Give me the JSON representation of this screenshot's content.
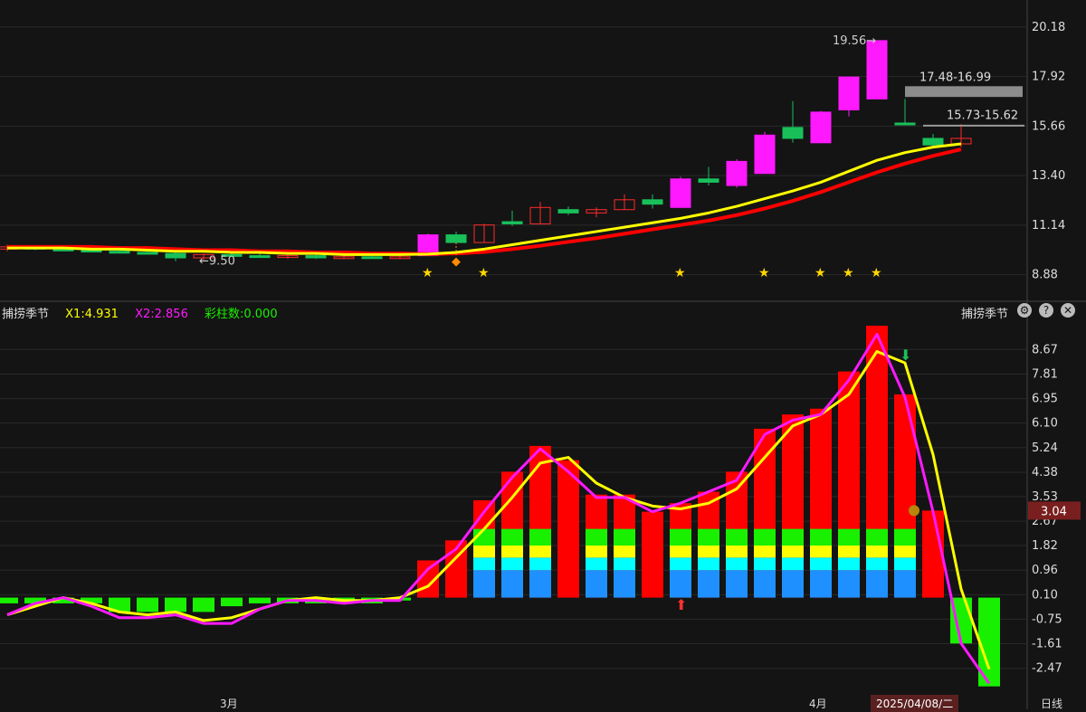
{
  "chart_data": [
    {
      "type": "candlestick",
      "price_axis_ticks": [
        "20.18",
        "17.92",
        "15.66",
        "13.40",
        "11.14",
        "8.88"
      ],
      "ylim": [
        8.0,
        21.0
      ],
      "candles": [
        {
          "o": 10.05,
          "h": 10.25,
          "l": 9.95,
          "c": 10.15
        },
        {
          "o": 10.15,
          "h": 10.2,
          "l": 10.0,
          "c": 10.05
        },
        {
          "o": 10.05,
          "h": 10.15,
          "l": 9.95,
          "c": 10.0
        },
        {
          "o": 10.0,
          "h": 10.1,
          "l": 9.9,
          "c": 9.95
        },
        {
          "o": 9.95,
          "h": 10.05,
          "l": 9.85,
          "c": 9.9
        },
        {
          "o": 9.9,
          "h": 10.0,
          "l": 9.8,
          "c": 9.85
        },
        {
          "o": 9.85,
          "h": 9.95,
          "l": 9.5,
          "c": 9.65
        },
        {
          "o": 9.65,
          "h": 9.85,
          "l": 9.55,
          "c": 9.8
        },
        {
          "o": 9.8,
          "h": 9.9,
          "l": 9.7,
          "c": 9.75
        },
        {
          "o": 9.75,
          "h": 9.85,
          "l": 9.65,
          "c": 9.7
        },
        {
          "o": 9.7,
          "h": 9.8,
          "l": 9.6,
          "c": 9.75
        },
        {
          "o": 9.75,
          "h": 9.8,
          "l": 9.6,
          "c": 9.65
        },
        {
          "o": 9.65,
          "h": 9.75,
          "l": 9.6,
          "c": 9.7
        },
        {
          "o": 9.7,
          "h": 9.75,
          "l": 9.6,
          "c": 9.65
        },
        {
          "o": 9.65,
          "h": 9.75,
          "l": 9.6,
          "c": 9.7
        },
        {
          "o": 9.75,
          "h": 10.75,
          "l": 9.75,
          "c": 10.7
        },
        {
          "o": 10.7,
          "h": 10.85,
          "l": 10.3,
          "c": 10.35
        },
        {
          "o": 10.35,
          "h": 11.2,
          "l": 10.35,
          "c": 11.15
        },
        {
          "o": 11.3,
          "h": 11.8,
          "l": 11.1,
          "c": 11.2
        },
        {
          "o": 11.2,
          "h": 12.2,
          "l": 11.2,
          "c": 11.95
        },
        {
          "o": 11.85,
          "h": 12.0,
          "l": 11.6,
          "c": 11.7
        },
        {
          "o": 11.7,
          "h": 11.95,
          "l": 11.5,
          "c": 11.85
        },
        {
          "o": 11.85,
          "h": 12.55,
          "l": 11.85,
          "c": 12.3
        },
        {
          "o": 12.3,
          "h": 12.55,
          "l": 11.9,
          "c": 12.1
        },
        {
          "o": 11.95,
          "h": 13.35,
          "l": 11.95,
          "c": 13.25
        },
        {
          "o": 13.25,
          "h": 13.8,
          "l": 12.95,
          "c": 13.1
        },
        {
          "o": 12.95,
          "h": 14.15,
          "l": 12.85,
          "c": 14.05
        },
        {
          "o": 13.5,
          "h": 15.4,
          "l": 13.5,
          "c": 15.25
        },
        {
          "o": 15.6,
          "h": 16.8,
          "l": 14.9,
          "c": 15.1
        },
        {
          "o": 14.9,
          "h": 16.35,
          "l": 14.9,
          "c": 16.3
        },
        {
          "o": 16.4,
          "h": 17.9,
          "l": 16.1,
          "c": 17.9
        },
        {
          "o": 16.9,
          "h": 19.56,
          "l": 16.9,
          "c": 19.56
        },
        {
          "o": 15.8,
          "h": 16.9,
          "l": 15.7,
          "c": 15.73
        },
        {
          "o": 15.1,
          "h": 15.3,
          "l": 14.75,
          "c": 14.8
        },
        {
          "o": 14.85,
          "h": 15.75,
          "l": 14.7,
          "c": 15.1
        }
      ],
      "ma_yellow": [
        10.1,
        10.1,
        10.1,
        10.05,
        10.05,
        10.0,
        9.95,
        9.95,
        9.9,
        9.9,
        9.85,
        9.85,
        9.8,
        9.8,
        9.8,
        9.82,
        9.9,
        10.05,
        10.25,
        10.45,
        10.65,
        10.85,
        11.05,
        11.25,
        11.45,
        11.7,
        12.0,
        12.35,
        12.7,
        13.1,
        13.6,
        14.1,
        14.45,
        14.7,
        14.85
      ],
      "ma_red": [
        10.15,
        10.15,
        10.15,
        10.15,
        10.1,
        10.1,
        10.05,
        10.0,
        10.0,
        9.95,
        9.95,
        9.9,
        9.9,
        9.85,
        9.85,
        9.82,
        9.85,
        9.92,
        10.05,
        10.2,
        10.38,
        10.55,
        10.75,
        10.95,
        11.15,
        11.35,
        11.6,
        11.9,
        12.25,
        12.65,
        13.1,
        13.55,
        13.95,
        14.3,
        14.6
      ],
      "annotations": {
        "high_label": "19.56→",
        "low_label": "←9.50",
        "band1": "17.48-16.99",
        "band2": "15.73-15.62"
      }
    },
    {
      "type": "bar+line",
      "indicator_name": "捕捞季节",
      "legend": {
        "x1": "X1:4.931",
        "x2": "X2:2.856",
        "bars": "彩柱数:0.000"
      },
      "value_axis_ticks": [
        "8.67",
        "7.81",
        "6.95",
        "6.10",
        "5.24",
        "4.38",
        "3.53",
        "2.67",
        "1.82",
        "0.96",
        "0.10",
        "-0.75",
        "-1.61",
        "-2.47"
      ],
      "current_value_label": "3.04",
      "ylim": [
        -3.3,
        9.5
      ],
      "bars": [
        -0.2,
        -0.2,
        -0.2,
        -0.2,
        -0.5,
        -0.5,
        -0.5,
        -0.5,
        -0.3,
        -0.2,
        -0.2,
        -0.2,
        -0.2,
        -0.2,
        -0.1,
        1.3,
        2.0,
        3.4,
        4.4,
        5.3,
        4.8,
        3.6,
        3.6,
        3.0,
        3.3,
        3.7,
        4.4,
        5.9,
        6.4,
        6.6,
        7.9,
        9.5,
        7.1,
        3.04,
        -1.6,
        -3.1
      ],
      "bar_colors": [
        "#19f000",
        "#19f000",
        "#19f000",
        "#19f000",
        "#19f000",
        "#19f000",
        "#19f000",
        "#19f000",
        "#19f000",
        "#19f000",
        "#19f000",
        "#19f000",
        "#19f000",
        "#19f000",
        "#19f000",
        "#ff0000",
        "#ff0000",
        "#ff0000",
        "#ff0000",
        "#ff0000",
        "#ff0000",
        "#ff0000",
        "#ff0000",
        "#ff0000",
        "#ff0000",
        "#ff0000",
        "#ff0000",
        "#ff0000",
        "#ff0000",
        "#ff0000",
        "#ff0000",
        "#ff0000",
        "#ff0000",
        "#ff0000",
        "#19f000",
        "#19f000"
      ],
      "rainbow_bars": [
        17,
        18,
        19,
        21,
        22,
        24,
        25,
        26,
        27,
        28,
        29,
        30,
        31,
        32
      ],
      "x1_yellow": [
        -0.6,
        -0.3,
        0.0,
        -0.2,
        -0.5,
        -0.6,
        -0.5,
        -0.8,
        -0.7,
        -0.4,
        -0.1,
        0.0,
        -0.1,
        -0.1,
        0.0,
        0.4,
        1.4,
        2.4,
        3.5,
        4.7,
        4.9,
        4.0,
        3.5,
        3.2,
        3.1,
        3.3,
        3.8,
        4.9,
        6.0,
        6.4,
        7.1,
        8.6,
        8.2,
        5.0,
        0.3,
        -2.5
      ],
      "x2_magenta": [
        -0.6,
        -0.2,
        0.0,
        -0.3,
        -0.7,
        -0.7,
        -0.6,
        -0.9,
        -0.9,
        -0.4,
        -0.1,
        -0.1,
        -0.2,
        -0.1,
        -0.1,
        1.0,
        1.7,
        3.0,
        4.2,
        5.2,
        4.4,
        3.5,
        3.5,
        3.0,
        3.3,
        3.7,
        4.1,
        5.7,
        6.2,
        6.4,
        7.6,
        9.2,
        7.0,
        3.0,
        -1.6,
        -3.0
      ]
    }
  ],
  "xaxis": {
    "month1": "3月",
    "month2": "4月",
    "date": "2025/04/08/二",
    "period": "日线"
  },
  "colors": {
    "up": "#ff2a2a",
    "down": "#19c05a",
    "magenta": "#ff19ff",
    "yellow": "#ffff00",
    "red": "#ff0000",
    "grid": "#2a2a2a"
  }
}
